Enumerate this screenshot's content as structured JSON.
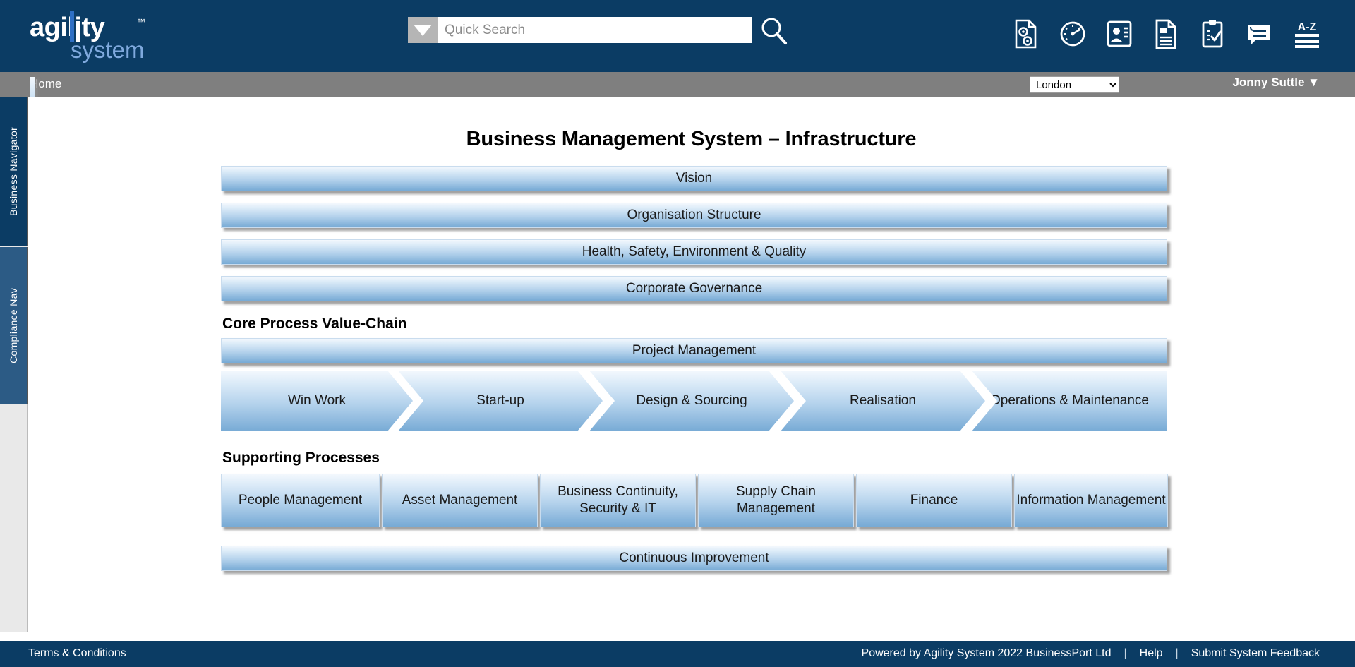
{
  "header": {
    "logo_main": "agility",
    "logo_tm": "™",
    "logo_sub": "system",
    "search": {
      "placeholder": "Quick Search",
      "value": "",
      "dropdown_icon": "triangle-down-icon",
      "search_icon": "search-icon"
    },
    "icons": [
      {
        "name": "document-settings-icon",
        "label": "Document Settings"
      },
      {
        "name": "dashboard-gauge-icon",
        "label": "Dashboard"
      },
      {
        "name": "contacts-icon",
        "label": "Contacts"
      },
      {
        "name": "document-icon",
        "label": "Documents"
      },
      {
        "name": "clipboard-check-icon",
        "label": "Tasks"
      },
      {
        "name": "feedback-bubble-icon",
        "label": "Feedback"
      },
      {
        "name": "glossary-az-icon",
        "label": "A-Z Glossary"
      }
    ]
  },
  "crumbbar": {
    "chevron": "»",
    "home": "Home",
    "location_selected": "London",
    "location_options": [
      "London"
    ],
    "user": "Jonny Suttle ▼"
  },
  "sidebar": {
    "tabs": [
      {
        "label": "Business Navigator",
        "active": true
      },
      {
        "label": "Compliance Nav",
        "active": false
      }
    ]
  },
  "main": {
    "title": "Business Management System – Infrastructure",
    "infrastructure_bars": [
      "Vision",
      "Organisation Structure",
      "Health, Safety, Environment & Quality",
      "Corporate Governance"
    ],
    "core_heading": "Core Process Value-Chain",
    "project_management_bar": "Project Management",
    "value_chain": [
      "Win Work",
      "Start-up",
      "Design & Sourcing",
      "Realisation",
      "Operations & Maintenance"
    ],
    "supporting_heading": "Supporting Processes",
    "supporting_boxes": [
      "People Management",
      "Asset Management",
      "Business Continuity, Security & IT",
      "Supply Chain Management",
      "Finance",
      "Information Management"
    ],
    "continuous_improvement_bar": "Continuous Improvement"
  },
  "footer": {
    "terms": "Terms & Conditions",
    "powered_by": "Powered by Agility System 2022 BusinessPort Ltd",
    "separator": "|",
    "help": "Help",
    "feedback": "Submit System Feedback"
  },
  "colors": {
    "header_navy": "#0b3c64",
    "crumb_grey": "#7f7f7f",
    "tab_active": "#0b3c64",
    "tab_inactive": "#2c5b85",
    "bar_gradient_top": "#f3f8fd",
    "bar_gradient_bottom": "#77aad5",
    "logo_sub_blue": "#7fa9dd"
  }
}
